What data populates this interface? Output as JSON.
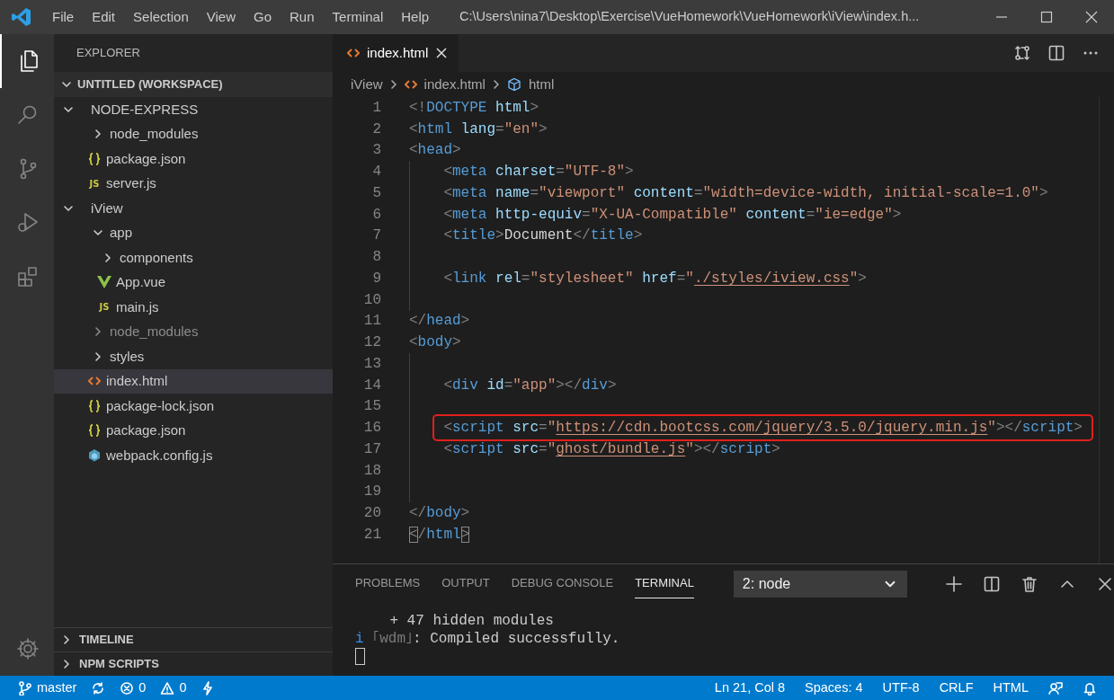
{
  "window": {
    "menu": [
      "File",
      "Edit",
      "Selection",
      "View",
      "Go",
      "Run",
      "Terminal",
      "Help"
    ],
    "title": "C:\\Users\\nina7\\Desktop\\Exercise\\VueHomework\\VueHomework\\iView\\index.h..."
  },
  "activity_bar": {
    "items": [
      {
        "kind": "files",
        "selected": true
      },
      {
        "kind": "search",
        "selected": false
      },
      {
        "kind": "source-control",
        "selected": false
      },
      {
        "kind": "run",
        "selected": false
      },
      {
        "kind": "extensions",
        "selected": false
      }
    ],
    "bottom": [
      {
        "kind": "settings"
      }
    ]
  },
  "sidebar": {
    "title": "EXPLORER",
    "workspace": {
      "label": "UNTITLED (WORKSPACE)",
      "expanded": true
    },
    "items": [
      {
        "label": "NODE-EXPRESS",
        "kind": "folder",
        "expanded": true,
        "selected": false,
        "dimmed": false,
        "children": [
          {
            "label": "node_modules",
            "kind": "folder",
            "expanded": false,
            "selected": false,
            "dimmed": false
          },
          {
            "label": "package.json",
            "kind": "json",
            "selected": false,
            "dimmed": false
          },
          {
            "label": "server.js",
            "kind": "js",
            "badge": "JS",
            "selected": false,
            "dimmed": false
          }
        ]
      },
      {
        "label": "iView",
        "kind": "folder",
        "expanded": true,
        "selected": false,
        "dimmed": false,
        "children": [
          {
            "label": "app",
            "kind": "folder",
            "expanded": true,
            "selected": false,
            "dimmed": false,
            "children": [
              {
                "label": "components",
                "kind": "folder",
                "expanded": false,
                "selected": false,
                "dimmed": false
              },
              {
                "label": "App.vue",
                "kind": "vue",
                "selected": false,
                "dimmed": false
              },
              {
                "label": "main.js",
                "kind": "js",
                "badge": "JS",
                "selected": false,
                "dimmed": false
              }
            ]
          },
          {
            "label": "node_modules",
            "kind": "folder",
            "expanded": false,
            "selected": false,
            "dimmed": true
          },
          {
            "label": "styles",
            "kind": "folder",
            "expanded": false,
            "selected": false,
            "dimmed": false
          },
          {
            "label": "index.html",
            "kind": "html",
            "selected": true,
            "dimmed": false
          },
          {
            "label": "package-lock.json",
            "kind": "json",
            "selected": false,
            "dimmed": false
          },
          {
            "label": "package.json",
            "kind": "json",
            "selected": false,
            "dimmed": false
          },
          {
            "label": "webpack.config.js",
            "kind": "webpack",
            "selected": false,
            "dimmed": false
          }
        ]
      }
    ],
    "sections": [
      {
        "label": "TIMELINE",
        "expanded": false
      },
      {
        "label": "NPM SCRIPTS",
        "expanded": false
      }
    ]
  },
  "editor": {
    "tabs": [
      {
        "label": "index.html",
        "kind": "html",
        "selected": true
      }
    ],
    "breadcrumb": [
      {
        "label": "iView",
        "kind": "folder"
      },
      {
        "label": "index.html",
        "kind": "html"
      },
      {
        "label": "html",
        "kind": "element"
      }
    ],
    "lines": [
      {
        "number": "1",
        "indented": false,
        "highlighted": false,
        "tokens": [
          {
            "kind": "p",
            "text": "<!"
          },
          {
            "kind": "tag",
            "text": "DOCTYPE"
          },
          {
            "kind": "attr",
            "text": " html"
          },
          {
            "kind": "p",
            "text": ">"
          }
        ]
      },
      {
        "number": "2",
        "indented": false,
        "highlighted": false,
        "tokens": [
          {
            "kind": "p",
            "text": "<"
          },
          {
            "kind": "tag",
            "text": "html"
          },
          {
            "kind": "attr",
            "text": " lang"
          },
          {
            "kind": "p",
            "text": "="
          },
          {
            "kind": "str",
            "text": "\"en\""
          },
          {
            "kind": "p",
            "text": ">"
          }
        ]
      },
      {
        "number": "3",
        "indented": false,
        "highlighted": false,
        "tokens": [
          {
            "kind": "p",
            "text": "<"
          },
          {
            "kind": "tag",
            "text": "head"
          },
          {
            "kind": "p",
            "text": ">"
          }
        ]
      },
      {
        "number": "4",
        "indented": true,
        "highlighted": false,
        "tokens": [
          {
            "kind": "p",
            "text": "<"
          },
          {
            "kind": "tag",
            "text": "meta"
          },
          {
            "kind": "attr",
            "text": " charset"
          },
          {
            "kind": "p",
            "text": "="
          },
          {
            "kind": "str",
            "text": "\"UTF-8\""
          },
          {
            "kind": "p",
            "text": ">"
          }
        ]
      },
      {
        "number": "5",
        "indented": true,
        "highlighted": false,
        "tokens": [
          {
            "kind": "p",
            "text": "<"
          },
          {
            "kind": "tag",
            "text": "meta"
          },
          {
            "kind": "attr",
            "text": " name"
          },
          {
            "kind": "p",
            "text": "="
          },
          {
            "kind": "str",
            "text": "\"viewport\""
          },
          {
            "kind": "attr",
            "text": " content"
          },
          {
            "kind": "p",
            "text": "="
          },
          {
            "kind": "str",
            "text": "\"width=device-width, initial-scale=1.0\""
          },
          {
            "kind": "p",
            "text": ">"
          }
        ]
      },
      {
        "number": "6",
        "indented": true,
        "highlighted": false,
        "tokens": [
          {
            "kind": "p",
            "text": "<"
          },
          {
            "kind": "tag",
            "text": "meta"
          },
          {
            "kind": "attr",
            "text": " http-equiv"
          },
          {
            "kind": "p",
            "text": "="
          },
          {
            "kind": "str",
            "text": "\"X-UA-Compatible\""
          },
          {
            "kind": "attr",
            "text": " content"
          },
          {
            "kind": "p",
            "text": "="
          },
          {
            "kind": "str",
            "text": "\"ie=edge\""
          },
          {
            "kind": "p",
            "text": ">"
          }
        ]
      },
      {
        "number": "7",
        "indented": true,
        "highlighted": false,
        "tokens": [
          {
            "kind": "p",
            "text": "<"
          },
          {
            "kind": "tag",
            "text": "title"
          },
          {
            "kind": "p",
            "text": ">"
          },
          {
            "kind": "text",
            "text": "Document"
          },
          {
            "kind": "p",
            "text": "</"
          },
          {
            "kind": "tag",
            "text": "title"
          },
          {
            "kind": "p",
            "text": ">"
          }
        ]
      },
      {
        "number": "8",
        "indented": true,
        "highlighted": false
      },
      {
        "number": "9",
        "indented": true,
        "highlighted": false,
        "tokens": [
          {
            "kind": "p",
            "text": "<"
          },
          {
            "kind": "tag",
            "text": "link"
          },
          {
            "kind": "attr",
            "text": " rel"
          },
          {
            "kind": "p",
            "text": "="
          },
          {
            "kind": "str",
            "text": "\"stylesheet\""
          },
          {
            "kind": "attr",
            "text": " href"
          },
          {
            "kind": "p",
            "text": "="
          },
          {
            "kind": "str",
            "text": "\""
          },
          {
            "kind": "link",
            "text": "./styles/iview.css"
          },
          {
            "kind": "str",
            "text": "\""
          },
          {
            "kind": "p",
            "text": ">"
          }
        ]
      },
      {
        "number": "10",
        "indented": true,
        "highlighted": false
      },
      {
        "number": "11",
        "indented": false,
        "highlighted": false,
        "tokens": [
          {
            "kind": "p",
            "text": "</"
          },
          {
            "kind": "tag",
            "text": "head"
          },
          {
            "kind": "p",
            "text": ">"
          }
        ]
      },
      {
        "number": "12",
        "indented": false,
        "highlighted": false,
        "tokens": [
          {
            "kind": "p",
            "text": "<"
          },
          {
            "kind": "tag",
            "text": "body"
          },
          {
            "kind": "p",
            "text": ">"
          }
        ]
      },
      {
        "number": "13",
        "indented": true,
        "highlighted": false
      },
      {
        "number": "14",
        "indented": true,
        "highlighted": false,
        "tokens": [
          {
            "kind": "p",
            "text": "<"
          },
          {
            "kind": "tag",
            "text": "div"
          },
          {
            "kind": "attr",
            "text": " id"
          },
          {
            "kind": "p",
            "text": "="
          },
          {
            "kind": "str",
            "text": "\"app\""
          },
          {
            "kind": "p",
            "text": "></"
          },
          {
            "kind": "tag",
            "text": "div"
          },
          {
            "kind": "p",
            "text": ">"
          }
        ]
      },
      {
        "number": "15",
        "indented": true,
        "highlighted": false
      },
      {
        "number": "16",
        "indented": true,
        "highlighted": true,
        "tokens": [
          {
            "kind": "p",
            "text": "<"
          },
          {
            "kind": "tag",
            "text": "script"
          },
          {
            "kind": "attr",
            "text": " src"
          },
          {
            "kind": "p",
            "text": "="
          },
          {
            "kind": "str",
            "text": "\""
          },
          {
            "kind": "link",
            "text": "https://cdn.bootcss.com/jquery/3.5.0/jquery.min.js"
          },
          {
            "kind": "str",
            "text": "\""
          },
          {
            "kind": "p",
            "text": "></"
          },
          {
            "kind": "tag",
            "text": "script"
          },
          {
            "kind": "p",
            "text": ">"
          }
        ]
      },
      {
        "number": "17",
        "indented": true,
        "highlighted": false,
        "tokens": [
          {
            "kind": "p",
            "text": "<"
          },
          {
            "kind": "tag",
            "text": "script"
          },
          {
            "kind": "attr",
            "text": " src"
          },
          {
            "kind": "p",
            "text": "="
          },
          {
            "kind": "str",
            "text": "\""
          },
          {
            "kind": "link",
            "text": "ghost/bundle.js"
          },
          {
            "kind": "str",
            "text": "\""
          },
          {
            "kind": "p",
            "text": "></"
          },
          {
            "kind": "tag",
            "text": "script"
          },
          {
            "kind": "p",
            "text": ">"
          }
        ]
      },
      {
        "number": "18",
        "indented": true,
        "highlighted": false
      },
      {
        "number": "19",
        "indented": true,
        "highlighted": false
      },
      {
        "number": "20",
        "indented": false,
        "highlighted": false,
        "tokens": [
          {
            "kind": "p",
            "text": "</"
          },
          {
            "kind": "tag",
            "text": "body"
          },
          {
            "kind": "p",
            "text": ">"
          }
        ]
      },
      {
        "number": "21",
        "indented": false,
        "highlighted": false,
        "tokens": [
          {
            "kind": "pmatch",
            "text": "<"
          },
          {
            "kind": "p",
            "text": "/"
          },
          {
            "kind": "tag",
            "text": "html"
          },
          {
            "kind": "pmatch",
            "text": ">"
          }
        ]
      }
    ]
  },
  "panel": {
    "tabs": [
      {
        "label": "PROBLEMS",
        "selected": false
      },
      {
        "label": "OUTPUT",
        "selected": false
      },
      {
        "label": "DEBUG CONSOLE",
        "selected": false
      },
      {
        "label": "TERMINAL",
        "selected": true
      }
    ],
    "terminal_select": "2: node",
    "lines": [
      [
        {
          "kind": "plain",
          "text": "    + 47 hidden modules"
        }
      ],
      [
        {
          "kind": "info",
          "text": "i"
        },
        {
          "kind": "dim",
          "text": " ｢wdm｣"
        },
        {
          "kind": "plain",
          "text": ": Compiled successfully."
        }
      ]
    ],
    "cursor": true
  },
  "status_bar": {
    "left": [
      {
        "kind": "branch",
        "text": "master"
      },
      {
        "kind": "sync"
      },
      {
        "kind": "errors",
        "text": "0"
      },
      {
        "kind": "warnings",
        "text": "0"
      },
      {
        "kind": "lightning"
      }
    ],
    "right": [
      {
        "kind": "text",
        "text": "Ln 21, Col 8"
      },
      {
        "kind": "text",
        "text": "Spaces: 4"
      },
      {
        "kind": "text",
        "text": "UTF-8"
      },
      {
        "kind": "text",
        "text": "CRLF"
      },
      {
        "kind": "text",
        "text": "HTML"
      },
      {
        "kind": "feedback"
      },
      {
        "kind": "bell"
      }
    ]
  }
}
